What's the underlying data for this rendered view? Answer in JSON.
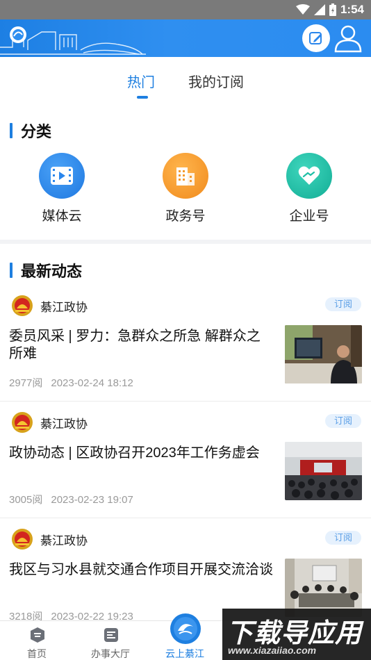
{
  "status_bar": {
    "time": "1:54"
  },
  "tabs": {
    "hot": "热门",
    "subscribed": "我的订阅"
  },
  "categories": {
    "title": "分类",
    "items": [
      {
        "label": "媒体云",
        "icon": "video-icon",
        "color": "#2a86ec"
      },
      {
        "label": "政务号",
        "icon": "building-icon",
        "color": "#f59a2c"
      },
      {
        "label": "企业号",
        "icon": "heart-handshake-icon",
        "color": "#1fbfa6"
      }
    ]
  },
  "news": {
    "title": "最新动态",
    "subscribe_label": "订阅",
    "items": [
      {
        "source": "綦江政协",
        "title": "委员风采 | 罗力：急群众之所急 解群众之所难",
        "views": "2977阅",
        "date": "2023-02-24 18:12"
      },
      {
        "source": "綦江政协",
        "title": "政协动态 | 区政协召开2023年工作务虚会",
        "views": "3005阅",
        "date": "2023-02-23 19:07"
      },
      {
        "source": "綦江政协",
        "title": "我区与习水县就交通合作项目开展交流洽谈",
        "views": "3218阅",
        "date": "2023-02-22 19:23"
      }
    ]
  },
  "bottom_nav": {
    "items": [
      {
        "label": "首页"
      },
      {
        "label": "办事大厅"
      },
      {
        "label": "云上綦江"
      }
    ]
  },
  "watermark": {
    "main": "下载导应用",
    "url": "www.xiazaiiao.com"
  },
  "colors": {
    "accent": "#1e7fe0"
  }
}
